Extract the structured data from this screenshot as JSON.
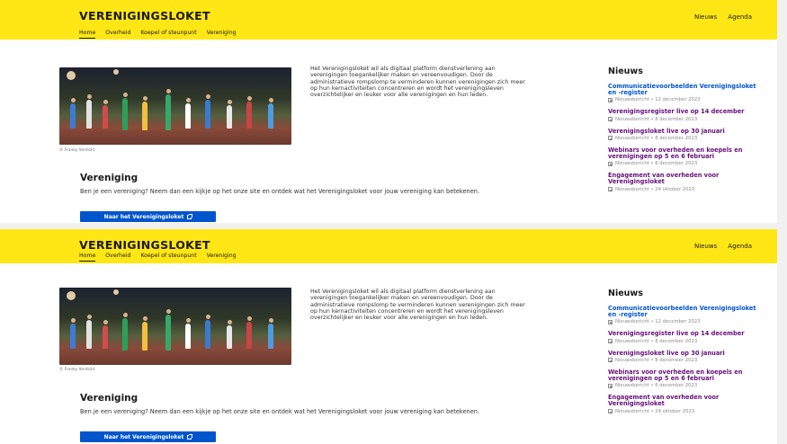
{
  "header": {
    "brand": "VERENIGINGSLOKET",
    "top_links": [
      "Nieuws",
      "Agenda"
    ],
    "nav": [
      "Home",
      "Overheid",
      "Koepel of steunpunt",
      "Vereniging"
    ],
    "active_nav": "Home"
  },
  "hero": {
    "photo_alt": "Children playing on a sports field",
    "credit": "© Franky Verdickt",
    "intro": "Het Verenigingsloket wil als digitaal platform dienstverlening aan verenigingen toegankelijker maken en vereenvoudigen. Door de administratieve rompslomp te verminderen kunnen verenigingen zich meer op hun kernactiviteiten concentreren en wordt het verenigingsleven overzichtelijker en leuker voor alle verenigingen en hun leden."
  },
  "section": {
    "title": "Vereniging",
    "text": "Ben je een vereniging? Neem dan een kijkje op het onze site en ontdek wat het Verenigingsloket voor jouw vereniging kan betekenen.",
    "button": "Naar het Verenigingsloket"
  },
  "news": {
    "title": "Nieuws",
    "items": [
      {
        "title": "Communicatievoorbeelden Verenigingsloket en -register",
        "meta": "Nieuwsbericht • 12 december 2023",
        "color": "#0055cc"
      },
      {
        "title": "Verenigingsregister live op 14 december",
        "meta": "Nieuwsbericht • 8 december 2023",
        "color": "#660e7a"
      },
      {
        "title": "Verenigingsloket live op 30 januari",
        "meta": "Nieuwsbericht • 8 december 2023",
        "color": "#660e7a"
      },
      {
        "title": "Webinars voor overheden en koepels en verenigingen op 5 en 6 februari",
        "meta": "Nieuwsbericht • 6 december 2023",
        "color": "#660e7a"
      },
      {
        "title": "Engagement van overheden voor Verenigingsloket",
        "meta": "Nieuwsbericht • 24 oktober 2023",
        "color": "#660e7a"
      }
    ]
  },
  "colors": {
    "header_bg": "#ffe615",
    "link_blue": "#0055cc",
    "link_visited": "#660e7a",
    "button_bg": "#0055cc"
  }
}
